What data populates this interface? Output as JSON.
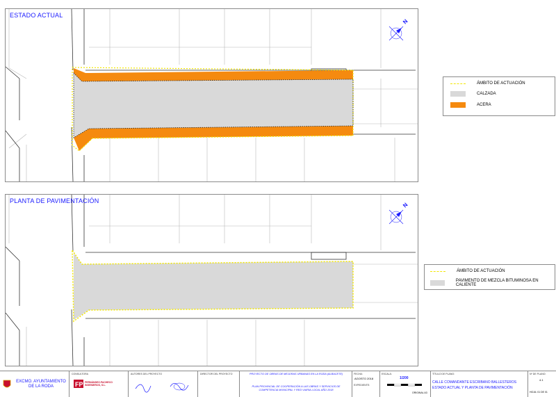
{
  "panels": {
    "top": {
      "title": "ESTADO ACTUAL"
    },
    "bottom": {
      "title": "PLANTA DE PAVIMENTACIÓN"
    }
  },
  "legend_top": {
    "items": [
      {
        "label": "ÁMBITO DE ACTUACIÓN",
        "kind": "dashed-line",
        "color": "#f2e600"
      },
      {
        "label": "CALZADA",
        "kind": "fill",
        "color": "#d9d9d9"
      },
      {
        "label": "ACERA",
        "kind": "fill",
        "color": "#f58a0f"
      }
    ]
  },
  "legend_bottom": {
    "items": [
      {
        "label": "ÁMBITO DE ACTUACIÓN",
        "kind": "dashed-line",
        "color": "#f2e600"
      },
      {
        "label": "PAVIMENTO DE MEZCLA BITUMINOSA EN CALIENTE",
        "kind": "fill",
        "color": "#d9d9d9"
      }
    ]
  },
  "north_arrow": {
    "letter": "N",
    "icon": "north-arrow-icon"
  },
  "title_block": {
    "client": "EXCMO. AYUNTAMIENTO\nDE LA RODA",
    "consultora_label": "CONSULTORA",
    "consultora_name": "FERNÁNDEZ-PACHECO INGENIEROS, S.L.",
    "autores_label": "AUTORES DEL PROYECTO",
    "director_label": "DIRECTOR DEL PROYECTO",
    "project_title": "PROYECTO DE OBRAS DE MEJORAS URBANAS EN LA RODA (ALBACETE)",
    "plan_title": "PLAN PROVINCIAL DE COOPERACIÓN A LAS OBRAS Y SERVICIOS DE COMPETENCIA MUNICIPAL Y RED VIARIA LOCAL AÑO 2018",
    "fecha_label": "FECHA:",
    "fecha": "AGOSTO 2018",
    "expediente_label": "EXPEDIENTE:",
    "escala_label": "ESCALA:",
    "escala": "1/200",
    "original": "ORIGINAL A3",
    "titulo_label": "TÍTULO DE PLANO:",
    "titulo_1": "CALLE COMANDANTE ESCRIBANO BALLESTEROS",
    "titulo_2": "ESTADO ACTUAL Y PLANTA DE PAVIMENTACIÓN",
    "plano_label": "Nº DE PLANO:",
    "plano": "4.1",
    "hoja": "HOJA: 01 DE 01"
  },
  "colors": {
    "calzada": "#d9d9d9",
    "acera": "#f58a0f",
    "ambito": "#f2e600",
    "title": "#1a1aff"
  }
}
